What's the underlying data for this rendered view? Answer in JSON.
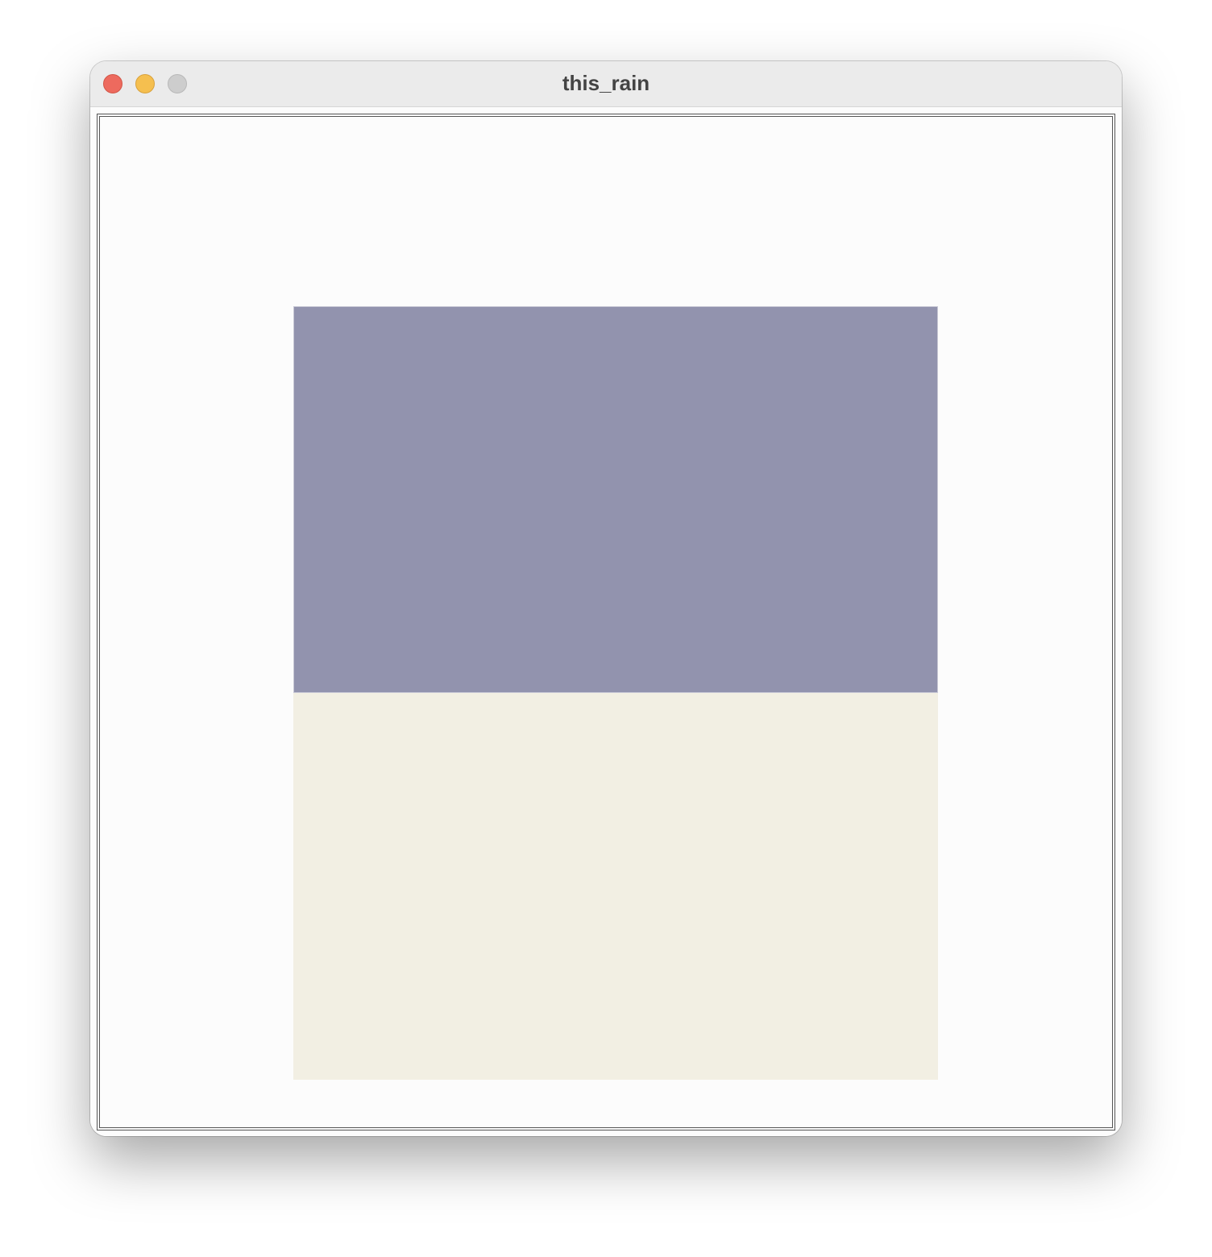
{
  "window": {
    "title": "this_rain"
  },
  "colors": {
    "titlebar": "#ebebeb",
    "close": "#ed6a5e",
    "minimize": "#f5bf4f",
    "zoom": "#cdcdcd",
    "canvas_background": "#fcfcfc",
    "frame_border": "#555555",
    "sky": "#9293ae",
    "ground": "#f2efe3"
  }
}
